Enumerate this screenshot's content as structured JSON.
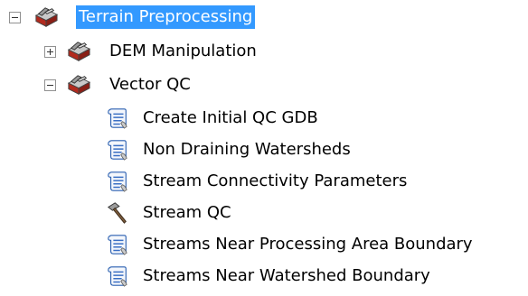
{
  "tree": {
    "root": {
      "label": "Terrain Preprocessing",
      "icon": "toolbox-icon",
      "expanded": true,
      "selected": true
    },
    "children": [
      {
        "label": "DEM Manipulation",
        "icon": "toolbox-icon",
        "expanded": false
      },
      {
        "label": "Vector QC",
        "icon": "toolbox-icon",
        "expanded": true
      }
    ],
    "vector_qc_items": [
      {
        "label": "Create Initial QC GDB",
        "icon": "script-icon"
      },
      {
        "label": "Non Draining Watersheds",
        "icon": "script-icon"
      },
      {
        "label": "Stream Connectivity Parameters",
        "icon": "script-icon"
      },
      {
        "label": "Stream QC",
        "icon": "hammer-icon"
      },
      {
        "label": "Streams Near Processing Area Boundary",
        "icon": "script-icon"
      },
      {
        "label": "Streams Near Watershed Boundary",
        "icon": "script-icon"
      }
    ]
  },
  "colors": {
    "selection": "#3399ff",
    "toolbox_red": "#c0392b",
    "script_blue": "#3a6fc4"
  }
}
